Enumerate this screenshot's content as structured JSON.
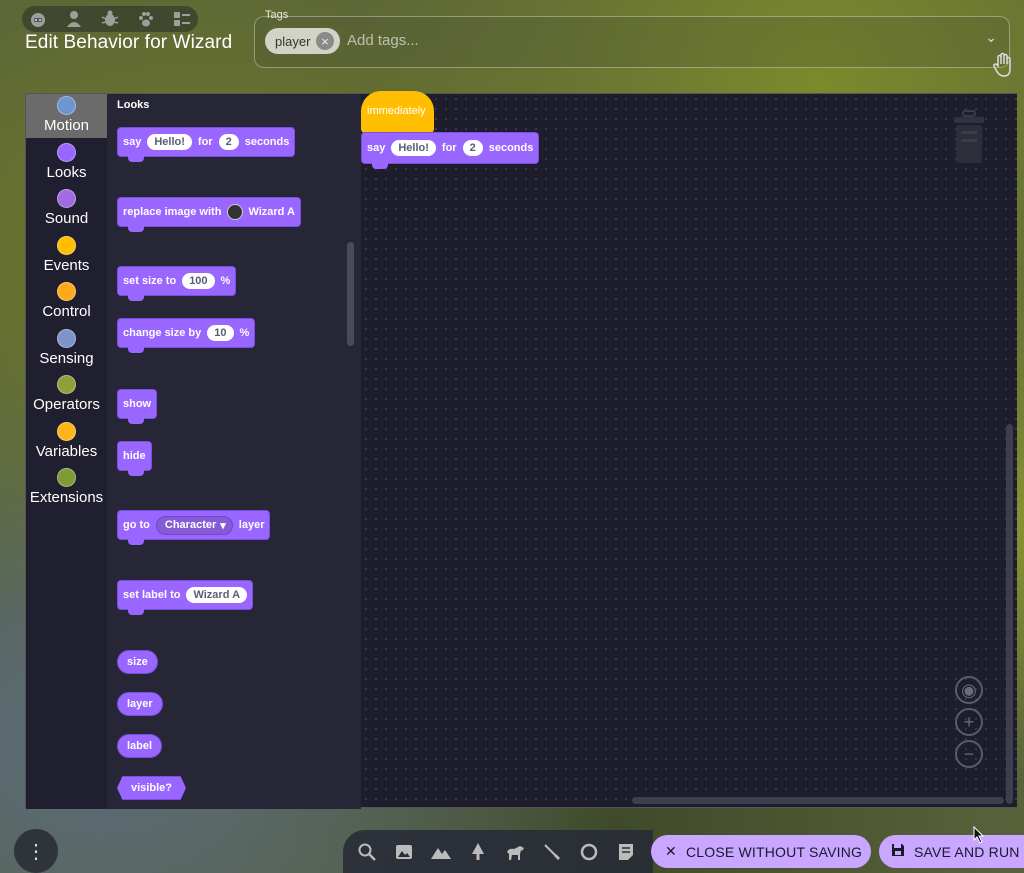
{
  "header": {
    "title": "Edit Behavior for Wizard",
    "icons": [
      "robot-icon",
      "person-icon",
      "bug-icon",
      "paw-icon",
      "list-icon"
    ]
  },
  "tags": {
    "label": "Tags",
    "chips": [
      "player"
    ],
    "placeholder": "Add tags..."
  },
  "categories": [
    {
      "label": "Motion",
      "color": "#6f95d1",
      "selected": true
    },
    {
      "label": "Looks",
      "color": "#9966ff"
    },
    {
      "label": "Sound",
      "color": "#a06be3"
    },
    {
      "label": "Events",
      "color": "#ffbf00"
    },
    {
      "label": "Control",
      "color": "#ffab19"
    },
    {
      "label": "Sensing",
      "color": "#7c95c8"
    },
    {
      "label": "Operators",
      "color": "#8fa03a"
    },
    {
      "label": "Variables",
      "color": "#ffb41a"
    },
    {
      "label": "Extensions",
      "color": "#7f9a36"
    }
  ],
  "flyout": {
    "title": "Looks",
    "say": {
      "label": "say",
      "value": "Hello!",
      "for": "for",
      "seconds_value": "2",
      "seconds": "seconds"
    },
    "replace_image": {
      "label": "replace image with",
      "costume": "Wizard A"
    },
    "set_size": {
      "label": "set size to",
      "value": "100",
      "unit": "%"
    },
    "change_size": {
      "label": "change size by",
      "value": "10",
      "unit": "%"
    },
    "show": "show",
    "hide": "hide",
    "go_to_layer": {
      "label": "go to",
      "option": "Character",
      "suffix": "layer"
    },
    "set_label": {
      "label": "set label to",
      "value": "Wizard A"
    },
    "reporters": [
      "size",
      "layer",
      "label"
    ],
    "boolean": "visible?"
  },
  "workspace": {
    "hat_label": "immediately",
    "say_block": {
      "label": "say",
      "value": "Hello!",
      "for": "for",
      "seconds_value": "2",
      "seconds": "seconds"
    }
  },
  "toolbar": {
    "tools": [
      "search-icon",
      "image-icon",
      "mountain-icon",
      "tree-icon",
      "horse-icon",
      "brush-icon",
      "loop-icon",
      "note-icon"
    ],
    "close_label": "CLOSE WITHOUT SAVING",
    "save_label": "SAVE AND RUN"
  }
}
